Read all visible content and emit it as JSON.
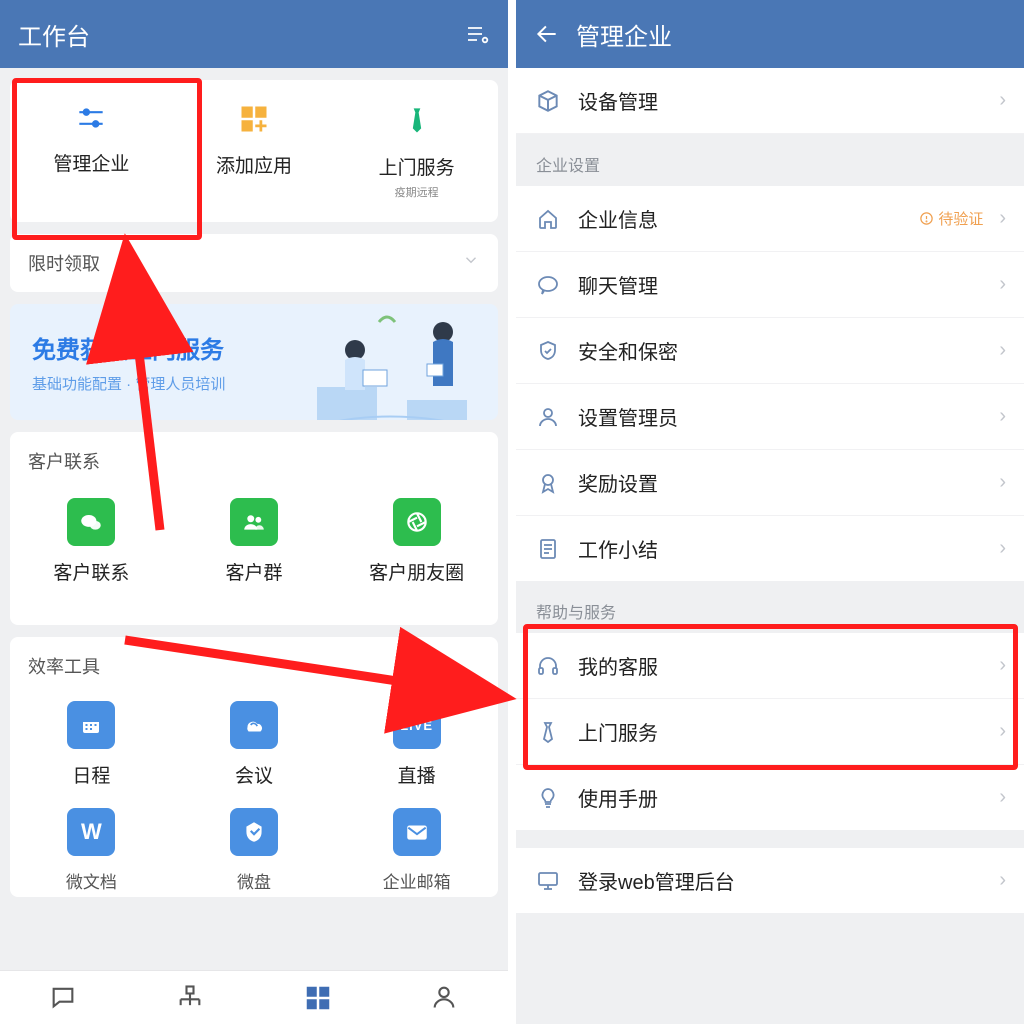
{
  "left": {
    "header_title": "工作台",
    "top_tiles": [
      {
        "label": "管理企业",
        "name": "manage-enterprise"
      },
      {
        "label": "添加应用",
        "name": "add-app"
      },
      {
        "label": "上门服务",
        "name": "onsite-service",
        "sub": "疫期远程"
      }
    ],
    "limited_title": "限时领取",
    "promo_title": "免费获取上门服务",
    "promo_sub": "基础功能配置 · 管理人员培训",
    "customer_section": "客户联系",
    "customer_tiles": [
      {
        "label": "客户联系",
        "name": "customer-contact"
      },
      {
        "label": "客户群",
        "name": "customer-group"
      },
      {
        "label": "客户朋友圈",
        "name": "customer-moments"
      }
    ],
    "tools_section": "效率工具",
    "tool_tiles": [
      {
        "label": "日程",
        "name": "calendar"
      },
      {
        "label": "会议",
        "name": "meeting"
      },
      {
        "label": "直播",
        "name": "live",
        "badge": "LIVE"
      },
      {
        "label": "微文档",
        "name": "wedoc",
        "glyph": "W"
      },
      {
        "label": "微盘",
        "name": "wedrive"
      },
      {
        "label": "企业邮箱",
        "name": "enterprise-mail"
      }
    ]
  },
  "right": {
    "header_title": "管理企业",
    "top_item": {
      "label": "设备管理"
    },
    "group1_title": "企业设置",
    "group1_items": [
      {
        "label": "企业信息",
        "badge": "待验证",
        "icon": "home"
      },
      {
        "label": "聊天管理",
        "icon": "chat"
      },
      {
        "label": "安全和保密",
        "icon": "shield"
      },
      {
        "label": "设置管理员",
        "icon": "person"
      },
      {
        "label": "奖励设置",
        "icon": "award"
      },
      {
        "label": "工作小结",
        "icon": "doc"
      }
    ],
    "group2_title": "帮助与服务",
    "group2_items": [
      {
        "label": "我的客服",
        "icon": "headset"
      },
      {
        "label": "上门服务",
        "icon": "tie"
      },
      {
        "label": "使用手册",
        "icon": "bulb"
      }
    ],
    "group3_items": [
      {
        "label": "登录web管理后台",
        "icon": "monitor"
      }
    ]
  }
}
